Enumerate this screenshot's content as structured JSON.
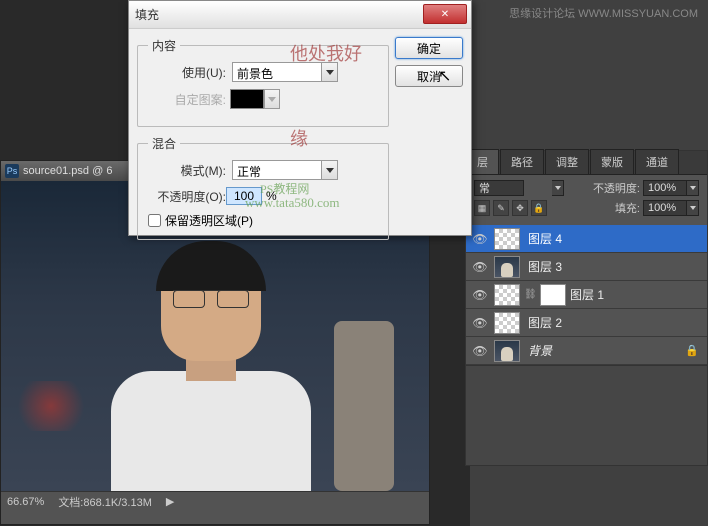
{
  "topbar_text": "思缘设计论坛 WWW.MISSYUAN.COM",
  "doc": {
    "title": "source01.psd @ 6",
    "zoom": "66.67%",
    "file_label": "文档:",
    "file_size": "868.1K/3.13M"
  },
  "dialog": {
    "title": "填充",
    "close": "✕",
    "content_legend": "内容",
    "use_label": "使用(U):",
    "use_value": "前景色",
    "custom_label": "自定图案:",
    "blend_legend": "混合",
    "mode_label": "模式(M):",
    "mode_value": "正常",
    "opacity_label": "不透明度(O):",
    "opacity_value": "100",
    "opacity_pct": "%",
    "preserve_label": "保留透明区域(P)",
    "ok": "确定",
    "cancel": "取消"
  },
  "panels": {
    "tabs": [
      "层",
      "路径",
      "调整",
      "蒙版",
      "通道"
    ],
    "blend_mode": "常",
    "opacity_label": "不透明度:",
    "opacity_value": "100%",
    "lock_label": "",
    "fill_label": "填充:",
    "fill_value": "100%"
  },
  "layers": [
    {
      "name": "图层 4",
      "thumb": "checker",
      "selected": true,
      "eye": true
    },
    {
      "name": "图层 3",
      "thumb": "photo",
      "selected": false,
      "eye": true
    },
    {
      "name": "图层 1",
      "thumb": "checker",
      "mask": true,
      "link": true,
      "selected": false,
      "eye": true
    },
    {
      "name": "图层 2",
      "thumb": "checker",
      "selected": false,
      "eye": true
    },
    {
      "name": "背景",
      "thumb": "photo",
      "italic": true,
      "locked": true,
      "selected": false,
      "eye": true
    }
  ],
  "watermarks": {
    "w1": "他处我好",
    "w2": "缘",
    "w3": "PS教程网",
    "w4": "www.tata580.com"
  }
}
